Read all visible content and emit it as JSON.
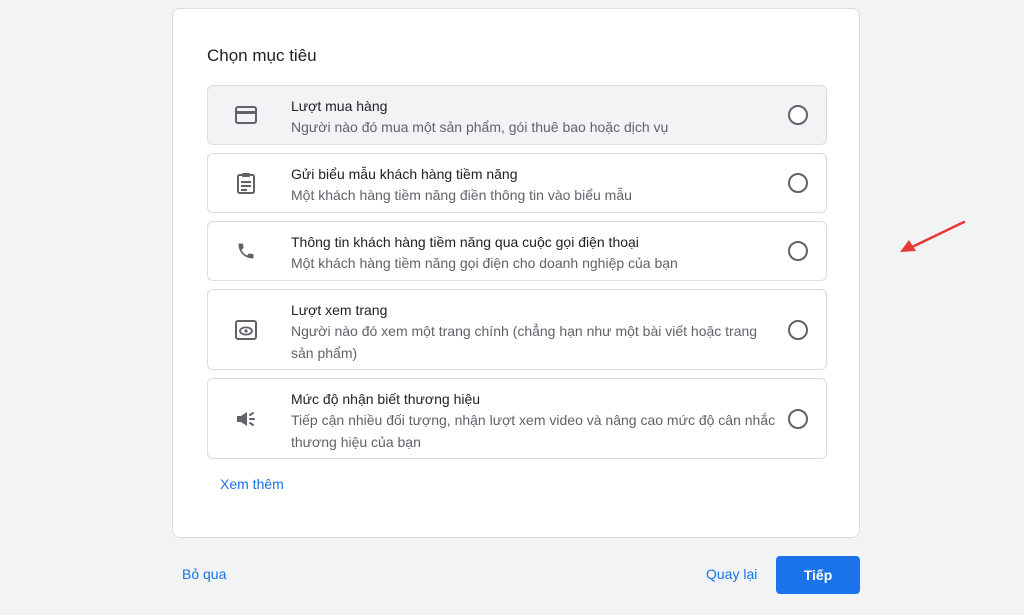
{
  "card": {
    "title": "Chọn mục tiêu",
    "see_more": "Xem thêm"
  },
  "options": [
    {
      "icon": "credit-card-icon",
      "title": "Lượt mua hàng",
      "desc": "Người nào đó mua một sản phẩm, gói thuê bao hoặc dịch vụ"
    },
    {
      "icon": "clipboard-form-icon",
      "title": "Gửi biểu mẫu khách hàng tiềm năng",
      "desc": "Một khách hàng tiềm năng điền thông tin vào biểu mẫu"
    },
    {
      "icon": "phone-icon",
      "title": "Thông tin khách hàng tiềm năng qua cuộc gọi điện thoại",
      "desc": "Một khách hàng tiềm năng gọi điện cho doanh nghiệp của bạn"
    },
    {
      "icon": "page-view-icon",
      "title": "Lượt xem trang",
      "desc": "Người nào đó xem một trang chính (chẳng hạn như một bài viết hoặc trang sản phẩm)"
    },
    {
      "icon": "megaphone-icon",
      "title": "Mức độ nhận biết thương hiệu",
      "desc": "Tiếp cận nhiều đối tượng, nhận lượt xem video và nâng cao mức độ cân nhắc thương hiệu của bạn"
    }
  ],
  "footer": {
    "skip": "Bỏ qua",
    "back": "Quay lại",
    "next": "Tiếp"
  },
  "colors": {
    "accent": "#1a73e8",
    "annotation_arrow": "#e53935"
  }
}
